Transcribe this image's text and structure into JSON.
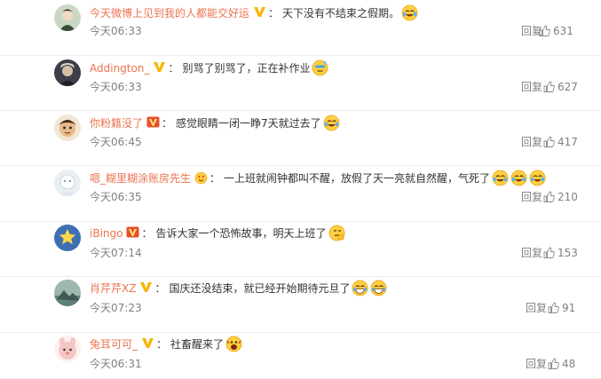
{
  "comments": [
    {
      "user": "今天微博上见到我的人都能交好运",
      "badge": "vip",
      "text": "天下没有不结束之假期。",
      "emojis": [
        "laugh-cry"
      ],
      "time": "今天06:33",
      "reply": "回复",
      "likes": "631",
      "avatar_color": "#c9d7c4"
    },
    {
      "user": "Addington_",
      "badge": "vip",
      "text": "别骂了别骂了，正在补作业",
      "emojis": [
        "sweat"
      ],
      "time": "今天06:33",
      "reply": "回复",
      "likes": "627",
      "avatar_color": "#3c3f4a"
    },
    {
      "user": "你粉籍没了",
      "badge": "vip-red",
      "text": "感觉眼睛一闭一睁7天就过去了",
      "emojis": [
        "laugh-cry"
      ],
      "time": "今天06:45",
      "reply": "回复",
      "likes": "417",
      "avatar_color": "#7a5a3a"
    },
    {
      "user": "嗯_糊里糊涂账房先生",
      "badge": "heart-face",
      "text": "一上班就闹钟都叫不醒，放假了天一亮就自然醒，气死了",
      "emojis": [
        "laugh-cry",
        "laugh-cry",
        "laugh-cry"
      ],
      "time": "今天06:35",
      "reply": "回复",
      "likes": "210",
      "avatar_color": "#e8eef2"
    },
    {
      "user": "iBingo",
      "badge": "vip-red",
      "text": "告诉大家一个恐怖故事，明天上班了",
      "emojis": [
        "think"
      ],
      "time": "今天07:14",
      "reply": "回复",
      "likes": "153",
      "avatar_color": "#3d6fb4"
    },
    {
      "user": "肖芹芹XZ",
      "badge": "vip",
      "text": "国庆还没结束，就已经开始期待元旦了",
      "emojis": [
        "grin",
        "grin"
      ],
      "time": "今天07:23",
      "reply": "回复",
      "likes": "91",
      "avatar_color": "#5f7f7a"
    },
    {
      "user": "兔耳可可_",
      "badge": "vip",
      "text": "社畜醒来了",
      "emojis": [
        "scream"
      ],
      "time": "今天06:31",
      "reply": "回复",
      "likes": "48",
      "avatar_color": "#f5c6c6"
    }
  ],
  "colors": {
    "username": "#eb7350",
    "meta": "#808080",
    "vip_gold": "#f7b500",
    "vip_red": "#e94e28"
  }
}
